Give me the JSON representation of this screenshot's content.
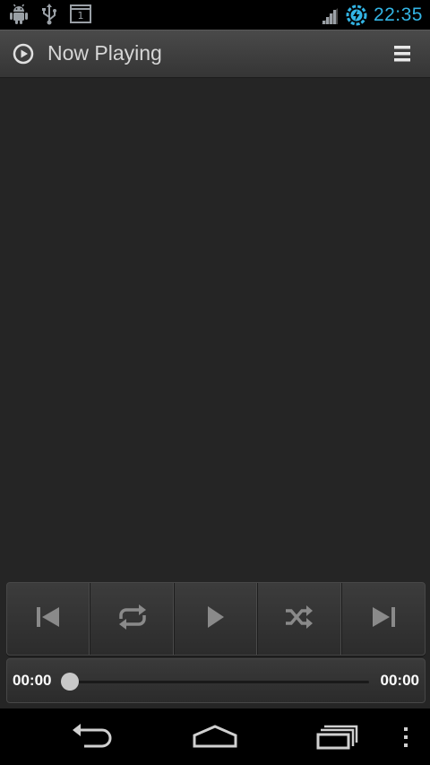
{
  "status_bar": {
    "time": "22:35",
    "icons": [
      "android-icon",
      "usb-icon",
      "notification-count-icon",
      "signal-icon",
      "sync-icon"
    ],
    "notification_count": "1"
  },
  "action_bar": {
    "title": "Now Playing",
    "app_icon": "play-circle-icon",
    "overflow_icon": "overflow-menu-icon"
  },
  "controls": [
    {
      "name": "previous-button",
      "icon": "skip-previous-icon"
    },
    {
      "name": "repeat-button",
      "icon": "repeat-icon"
    },
    {
      "name": "play-button",
      "icon": "play-icon"
    },
    {
      "name": "shuffle-button",
      "icon": "shuffle-icon"
    },
    {
      "name": "next-button",
      "icon": "skip-next-icon"
    }
  ],
  "seek": {
    "elapsed": "00:00",
    "total": "00:00",
    "progress": 0
  },
  "nav_bar": {
    "icons": [
      "back-icon",
      "home-icon",
      "recent-apps-icon",
      "menu-icon"
    ]
  },
  "colors": {
    "accent": "#33b5e5",
    "background": "#252525",
    "action_bar": "#404040"
  }
}
